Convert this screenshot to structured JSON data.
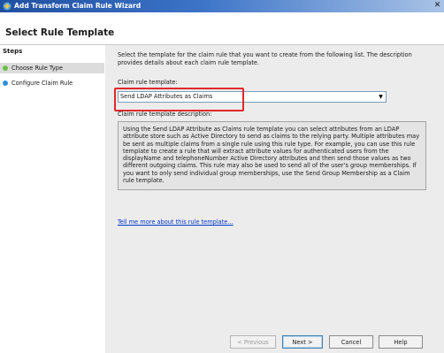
{
  "window": {
    "title": "Add Transform Claim Rule Wizard",
    "close_glyph": "✕",
    "icon": "wizard-icon"
  },
  "header": {
    "page_title": "Select Rule Template"
  },
  "steps": {
    "heading": "Steps",
    "items": [
      {
        "label": "Choose Rule Type",
        "state": "current",
        "color": "#6bbf47"
      },
      {
        "label": "Configure Claim Rule",
        "state": "pending",
        "color": "#2f8fd8"
      }
    ]
  },
  "main": {
    "instructions": "Select the template for the claim rule that you want to create from the following list. The description provides details about each claim rule template.",
    "template_label": "Claim rule template:",
    "template_value": "Send LDAP Attributes as Claims",
    "description_label": "Claim rule template description:",
    "description": "Using the Send LDAP Attribute as Claims rule template you can select attributes from an LDAP attribute store such as Active Directory to send as claims to the relying party. Multiple attributes may be sent as multiple claims from a single rule using this rule type. For example, you can use this rule template to create a rule that will extract attribute values for authenticated users from the displayName and telephoneNumber Active Directory attributes and then send those values as two different outgoing claims. This rule may also be used to send all of the user's group memberships. If you want to only send individual group memberships, use the Send Group Membership as a Claim rule template.",
    "help_link": "Tell me more about this rule template..."
  },
  "buttons": {
    "previous": "< Previous",
    "next": "Next >",
    "cancel": "Cancel",
    "help": "Help"
  },
  "colors": {
    "highlight": "#e0282c",
    "link": "#0033cc"
  }
}
